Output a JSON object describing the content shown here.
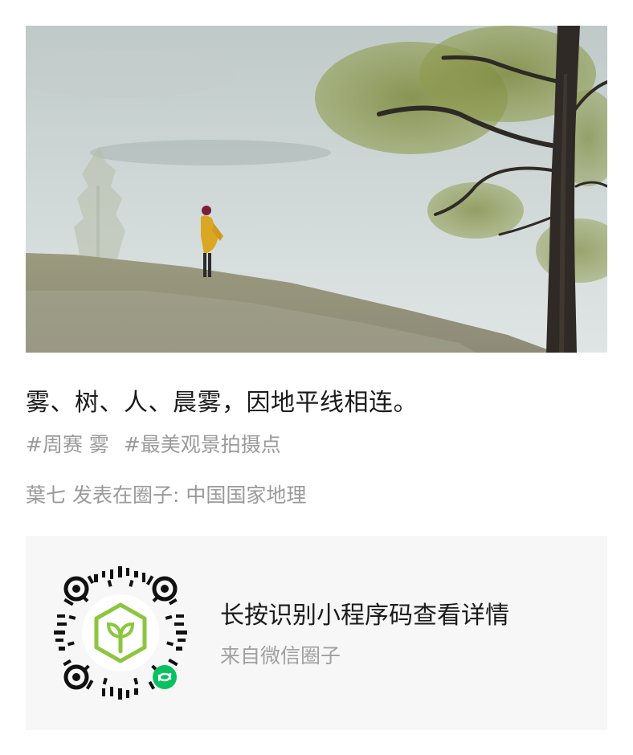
{
  "post": {
    "caption": "雾、树、人、晨雾，因地平线相连。",
    "tags": [
      "#周赛 雾",
      "#最美观景拍摄点"
    ],
    "source": "葉七 发表在圈子: 中国国家地理"
  },
  "mini_program_card": {
    "title": "长按识别小程序码查看详情",
    "subtitle": "来自微信圈子"
  }
}
